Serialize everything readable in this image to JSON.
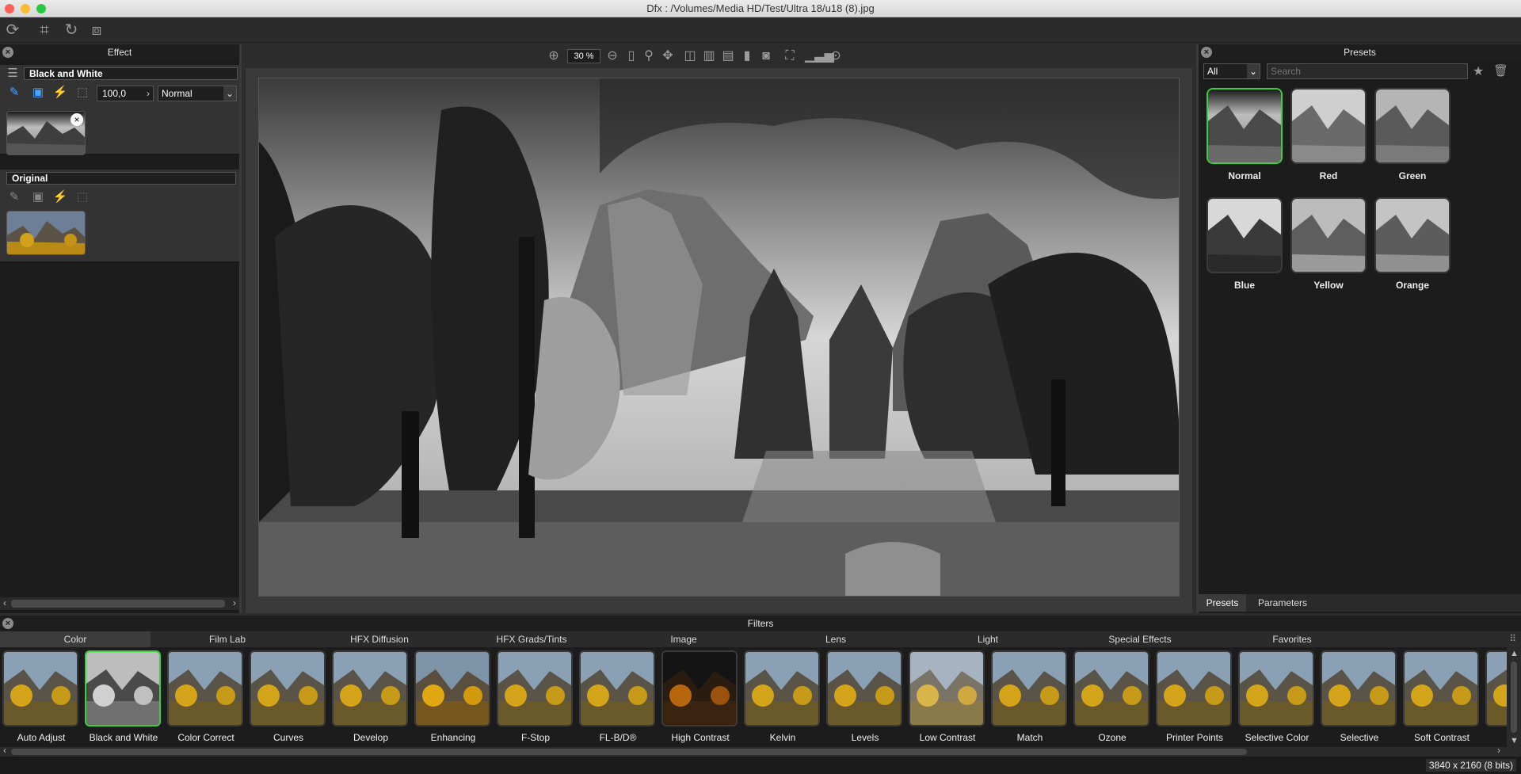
{
  "window": {
    "title": "Dfx : /Volumes/Media HD/Test/Ultra 18/u18 (8).jpg"
  },
  "effect_panel": {
    "title": "Effect",
    "layers": [
      {
        "name": "Black and White",
        "opacity": "100,0",
        "blend": "Normal"
      },
      {
        "name": "Original"
      }
    ]
  },
  "viewer": {
    "zoom": "30 %"
  },
  "presets_panel": {
    "title": "Presets",
    "filter": "All",
    "search_placeholder": "Search",
    "items": [
      "Normal",
      "Red",
      "Green",
      "Blue",
      "Yellow",
      "Orange"
    ],
    "selected": "Normal",
    "tabs": [
      "Presets",
      "Parameters"
    ],
    "active_tab": "Presets"
  },
  "filters_panel": {
    "title": "Filters",
    "categories": [
      "Color",
      "Film Lab",
      "HFX Diffusion",
      "HFX Grads/Tints",
      "Image",
      "Lens",
      "Light",
      "Special Effects",
      "Favorites"
    ],
    "active_category": "Color",
    "items": [
      "Auto Adjust",
      "Black and White",
      "Color Correct",
      "Curves",
      "Develop",
      "Enhancing",
      "F-Stop",
      "FL-B/D®",
      "High Contrast",
      "Kelvin",
      "Levels",
      "Low Contrast",
      "Match",
      "Ozone",
      "Printer Points",
      "Selective Color",
      "Selective",
      "Soft Contrast"
    ],
    "selected": "Black and White"
  },
  "status": {
    "image_info": "3840 x 2160 (8 bits)"
  },
  "colors": {
    "selection": "#3bd13b",
    "accent_icon": "#4aa3ff"
  }
}
